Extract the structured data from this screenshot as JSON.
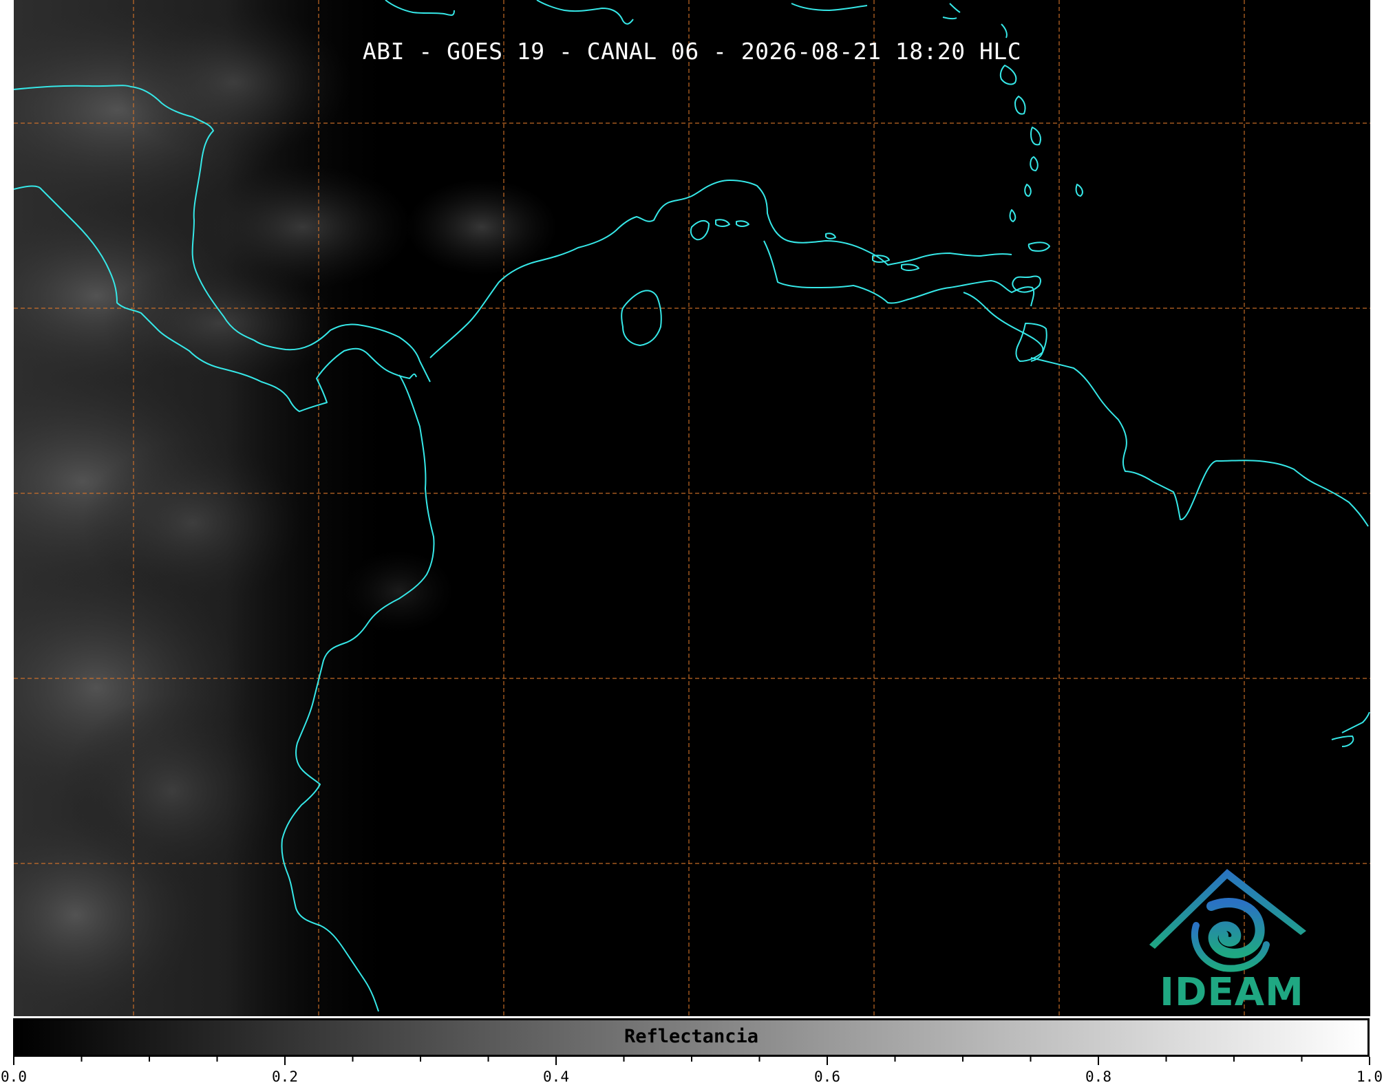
{
  "map": {
    "title": "ABI - GOES 19 - CANAL 06 - 2026-08-21 18:20 HLC",
    "coastline_color": "#36e8e8",
    "grid_color": "#d9762a",
    "background_color": "#000000",
    "grid_style": "dashed",
    "cloud_tone": "dark gray, western side"
  },
  "logo": {
    "text": "IDEAM",
    "color": "#1fa882",
    "icon": "ideam-mountain-spiral-icon"
  },
  "colorbar": {
    "label": "Reflectancia",
    "range": [
      0.0,
      1.0
    ],
    "gradient": [
      "#000000",
      "#ffffff"
    ],
    "tick_labels": [
      {
        "value": 0.0,
        "text": "0.0"
      },
      {
        "value": 0.2,
        "text": "0.2"
      },
      {
        "value": 0.4,
        "text": "0.4"
      },
      {
        "value": 0.6,
        "text": "0.6"
      },
      {
        "value": 0.8,
        "text": "0.8"
      },
      {
        "value": 1.0,
        "text": "1.0"
      }
    ],
    "minor_ticks": [
      0.05,
      0.1,
      0.15,
      0.25,
      0.3,
      0.35,
      0.45,
      0.5,
      0.55,
      0.65,
      0.7,
      0.75,
      0.85,
      0.9,
      0.95
    ]
  }
}
